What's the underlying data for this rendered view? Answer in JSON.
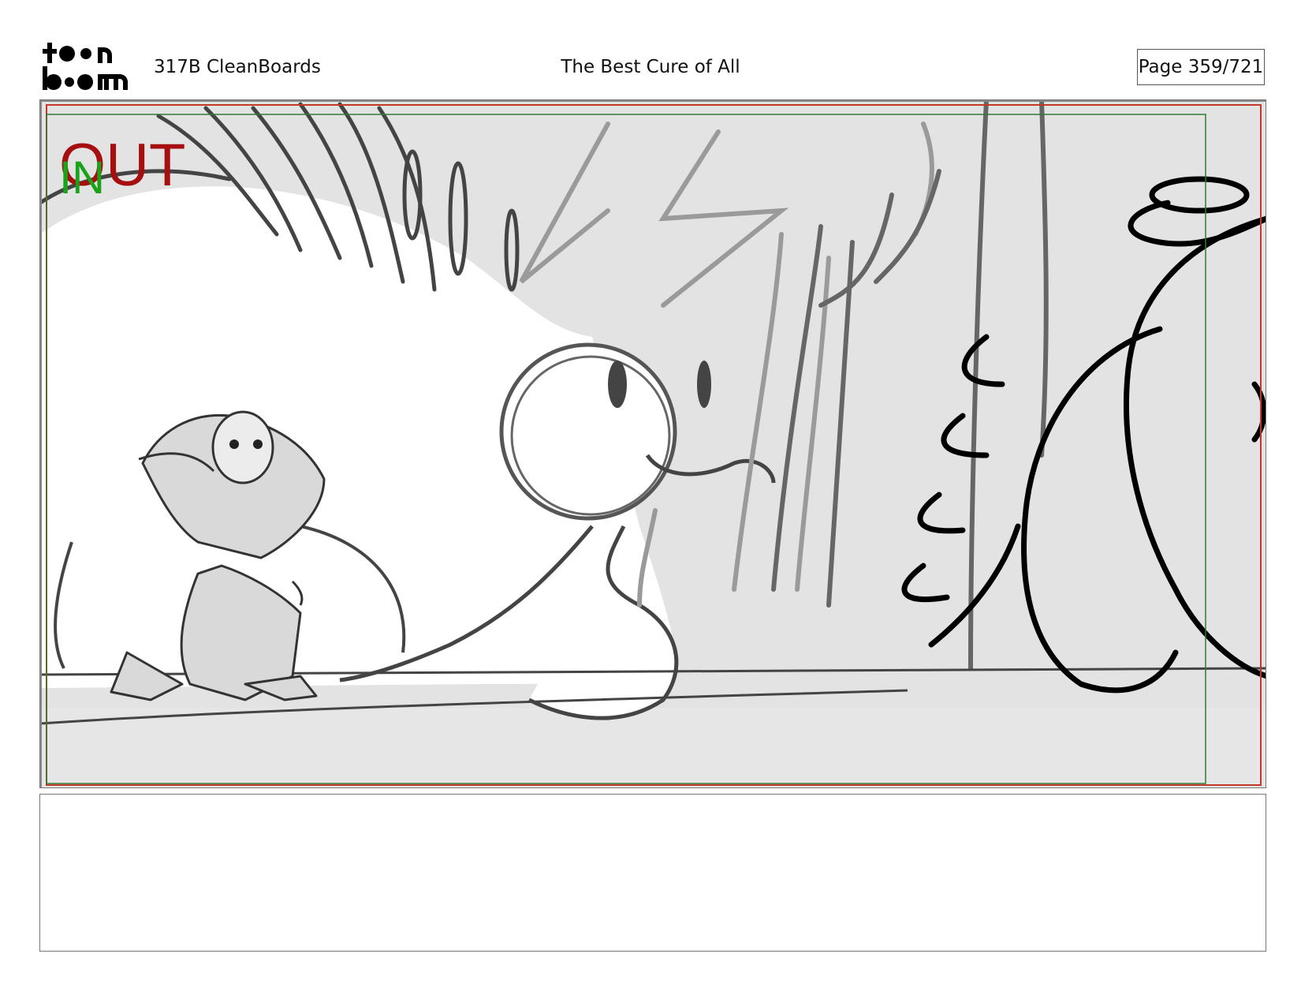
{
  "header": {
    "logo_text": "toonboom",
    "episode": "317B  CleanBoards",
    "title": "The Best Cure of All",
    "page": "Page 359/721"
  },
  "panel": {
    "marker_out": "OUT",
    "marker_in": "IN",
    "colors": {
      "out": "#a50f0f",
      "in": "#1aa31a",
      "frame_red": "#c0392b",
      "frame_green": "#2e7d32"
    }
  },
  "notes": {
    "text": ""
  }
}
